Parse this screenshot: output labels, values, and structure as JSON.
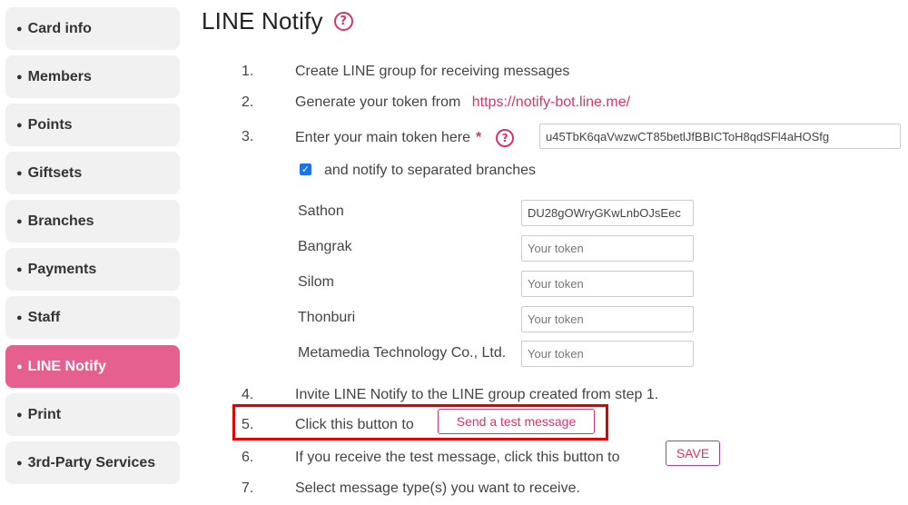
{
  "sidebar": {
    "items": [
      {
        "label": "Card info"
      },
      {
        "label": "Members"
      },
      {
        "label": "Points"
      },
      {
        "label": "Giftsets"
      },
      {
        "label": "Branches"
      },
      {
        "label": "Payments"
      },
      {
        "label": "Staff"
      },
      {
        "label": "LINE Notify",
        "active": true
      },
      {
        "label": "Print"
      },
      {
        "label": "3rd-Party Services"
      }
    ]
  },
  "page": {
    "title": "LINE Notify",
    "help_icon": "?"
  },
  "steps": {
    "s1": {
      "num": "1.",
      "text": "Create LINE group for receiving messages"
    },
    "s2": {
      "num": "2.",
      "text": "Generate your token from",
      "link": "https://notify-bot.line.me/"
    },
    "s3": {
      "num": "3.",
      "text": "Enter your main token here",
      "required": "*",
      "token_value": "u45TbK6qaVwzwCT85betlJfBBICToH8qdSFl4aHOSfg"
    },
    "checkbox_label": "and notify to separated branches",
    "s4": {
      "num": "4.",
      "text": "Invite LINE Notify to the LINE group created from step 1."
    },
    "s5": {
      "num": "5.",
      "text": "Click this button to",
      "button": "Send a test message"
    },
    "s6": {
      "num": "6.",
      "text": "If you receive the test message, click this button to",
      "button": "SAVE"
    },
    "s7": {
      "num": "7.",
      "text": "Select message type(s) you want to receive."
    }
  },
  "branches": [
    {
      "name": "Sathon",
      "value": "DU28gOWryGKwLnbOJsEec",
      "placeholder": "Your token"
    },
    {
      "name": "Bangrak",
      "value": "",
      "placeholder": "Your token"
    },
    {
      "name": "Silom",
      "value": "",
      "placeholder": "Your token"
    },
    {
      "name": "Thonburi",
      "value": "",
      "placeholder": "Your token"
    },
    {
      "name": "Metamedia Technology Co., Ltd.",
      "value": "",
      "placeholder": "Your token"
    }
  ],
  "colors": {
    "accent": "#e6608f",
    "link": "#d6336c",
    "highlight": "#e00000",
    "checkbox": "#1a73e8"
  }
}
